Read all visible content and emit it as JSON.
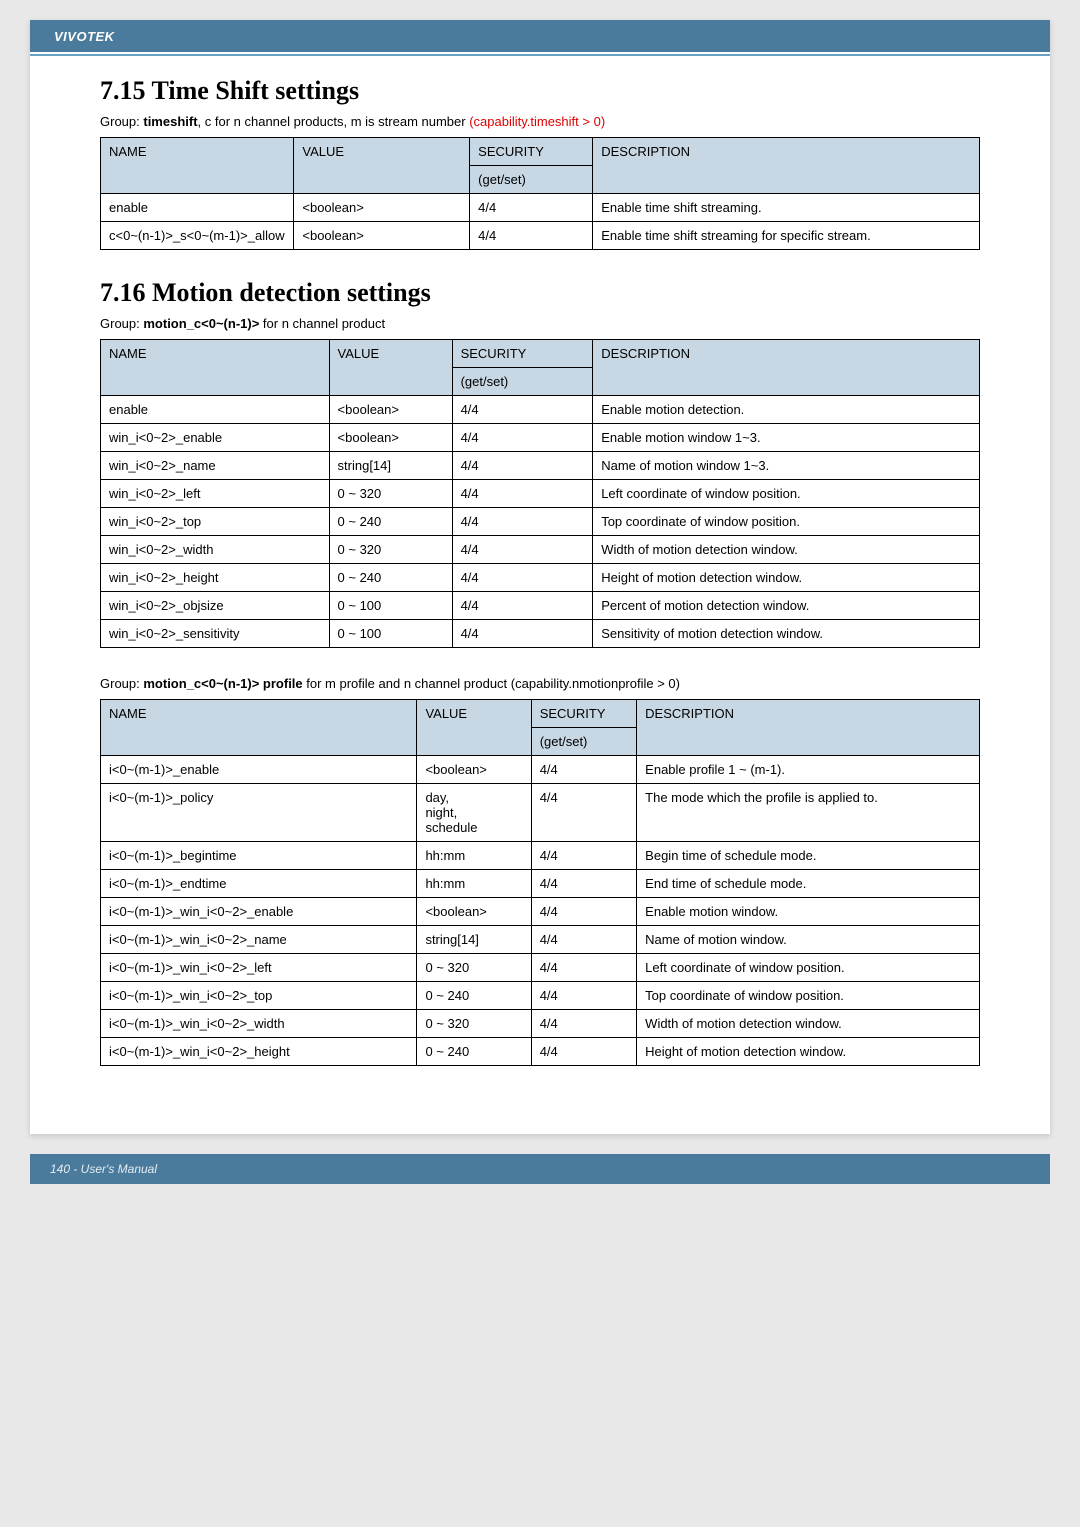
{
  "header": {
    "brand": "VIVOTEK"
  },
  "section1": {
    "heading": "7.15 Time Shift settings",
    "group_prefix": "Group: ",
    "group_bold": "timeshift",
    "group_rest": ", c for n channel products, m is stream number ",
    "group_red": "(capability.timeshift > 0)",
    "cols": {
      "name": "NAME",
      "value": "VALUE",
      "security": "SECURITY",
      "getset": "(get/set)",
      "desc": "DESCRIPTION"
    },
    "rows": [
      {
        "name": "enable",
        "value": "<boolean>",
        "security": "4/4",
        "desc": "Enable time shift streaming."
      },
      {
        "name": "c<0~(n-1)>_s<0~(m-1)>_allow",
        "value": "<boolean>",
        "security": "4/4",
        "desc": "Enable time shift streaming for specific stream."
      }
    ]
  },
  "section2": {
    "heading": "7.16 Motion detection settings",
    "group_prefix": "Group: ",
    "group_bold": "motion_c<0~(n-1)>",
    "group_rest": " for n channel product",
    "cols": {
      "name": "NAME",
      "value": "VALUE",
      "security": "SECURITY",
      "getset": "(get/set)",
      "desc": "DESCRIPTION"
    },
    "rows": [
      {
        "name": "enable",
        "value": "<boolean>",
        "security": "4/4",
        "desc": "Enable motion detection."
      },
      {
        "name": "win_i<0~2>_enable",
        "value": "<boolean>",
        "security": "4/4",
        "desc": "Enable motion window 1~3."
      },
      {
        "name": "win_i<0~2>_name",
        "value": "string[14]",
        "security": "4/4",
        "desc": "Name of motion window 1~3."
      },
      {
        "name": "win_i<0~2>_left",
        "value": "0 ~ 320",
        "security": "4/4",
        "desc": "Left coordinate of window position."
      },
      {
        "name": "win_i<0~2>_top",
        "value": "0 ~ 240",
        "security": "4/4",
        "desc": "Top coordinate of window position."
      },
      {
        "name": "win_i<0~2>_width",
        "value": "0 ~ 320",
        "security": "4/4",
        "desc": "Width of motion detection window."
      },
      {
        "name": "win_i<0~2>_height",
        "value": "0 ~ 240",
        "security": "4/4",
        "desc": "Height of motion detection window."
      },
      {
        "name": "win_i<0~2>_objsize",
        "value": "0 ~ 100",
        "security": "4/4",
        "desc": "Percent of motion detection window."
      },
      {
        "name": "win_i<0~2>_sensitivity",
        "value": "0 ~ 100",
        "security": "4/4",
        "desc": "Sensitivity of motion detection window."
      }
    ]
  },
  "section3": {
    "group_prefix": "Group: ",
    "group_bold": "motion_c<0~(n-1)> profile",
    "group_rest": " for m profile and n channel product (capability.nmotionprofile > 0)",
    "cols": {
      "name": "NAME",
      "value": "VALUE",
      "security": "SECURITY",
      "getset": "(get/set)",
      "desc": "DESCRIPTION"
    },
    "rows": [
      {
        "name": "i<0~(m-1)>_enable",
        "value": "<boolean>",
        "security": "4/4",
        "desc": "Enable profile 1 ~ (m-1)."
      },
      {
        "name": "i<0~(m-1)>_policy",
        "value": "day,\nnight,\nschedule",
        "security": "4/4",
        "desc": "The mode which the profile is applied to."
      },
      {
        "name": "i<0~(m-1)>_begintime",
        "value": "hh:mm",
        "security": "4/4",
        "desc": "Begin time of schedule mode."
      },
      {
        "name": "i<0~(m-1)>_endtime",
        "value": "hh:mm",
        "security": "4/4",
        "desc": "End time of schedule mode."
      },
      {
        "name": "i<0~(m-1)>_win_i<0~2>_enable",
        "value": "<boolean>",
        "security": "4/4",
        "desc": "Enable motion window."
      },
      {
        "name": "i<0~(m-1)>_win_i<0~2>_name",
        "value": "string[14]",
        "security": "4/4",
        "desc": "Name of motion window."
      },
      {
        "name": "i<0~(m-1)>_win_i<0~2>_left",
        "value": "0 ~ 320",
        "security": "4/4",
        "desc": "Left coordinate of window position."
      },
      {
        "name": "i<0~(m-1)>_win_i<0~2>_top",
        "value": "0 ~ 240",
        "security": "4/4",
        "desc": "Top coordinate of window position."
      },
      {
        "name": "i<0~(m-1)>_win_i<0~2>_width",
        "value": "0 ~ 320",
        "security": "4/4",
        "desc": "Width of motion detection window."
      },
      {
        "name": "i<0~(m-1)>_win_i<0~2>_height",
        "value": "0 ~ 240",
        "security": "4/4",
        "desc": "Height of motion detection window."
      }
    ]
  },
  "footer": {
    "text": "140 - User's Manual"
  }
}
